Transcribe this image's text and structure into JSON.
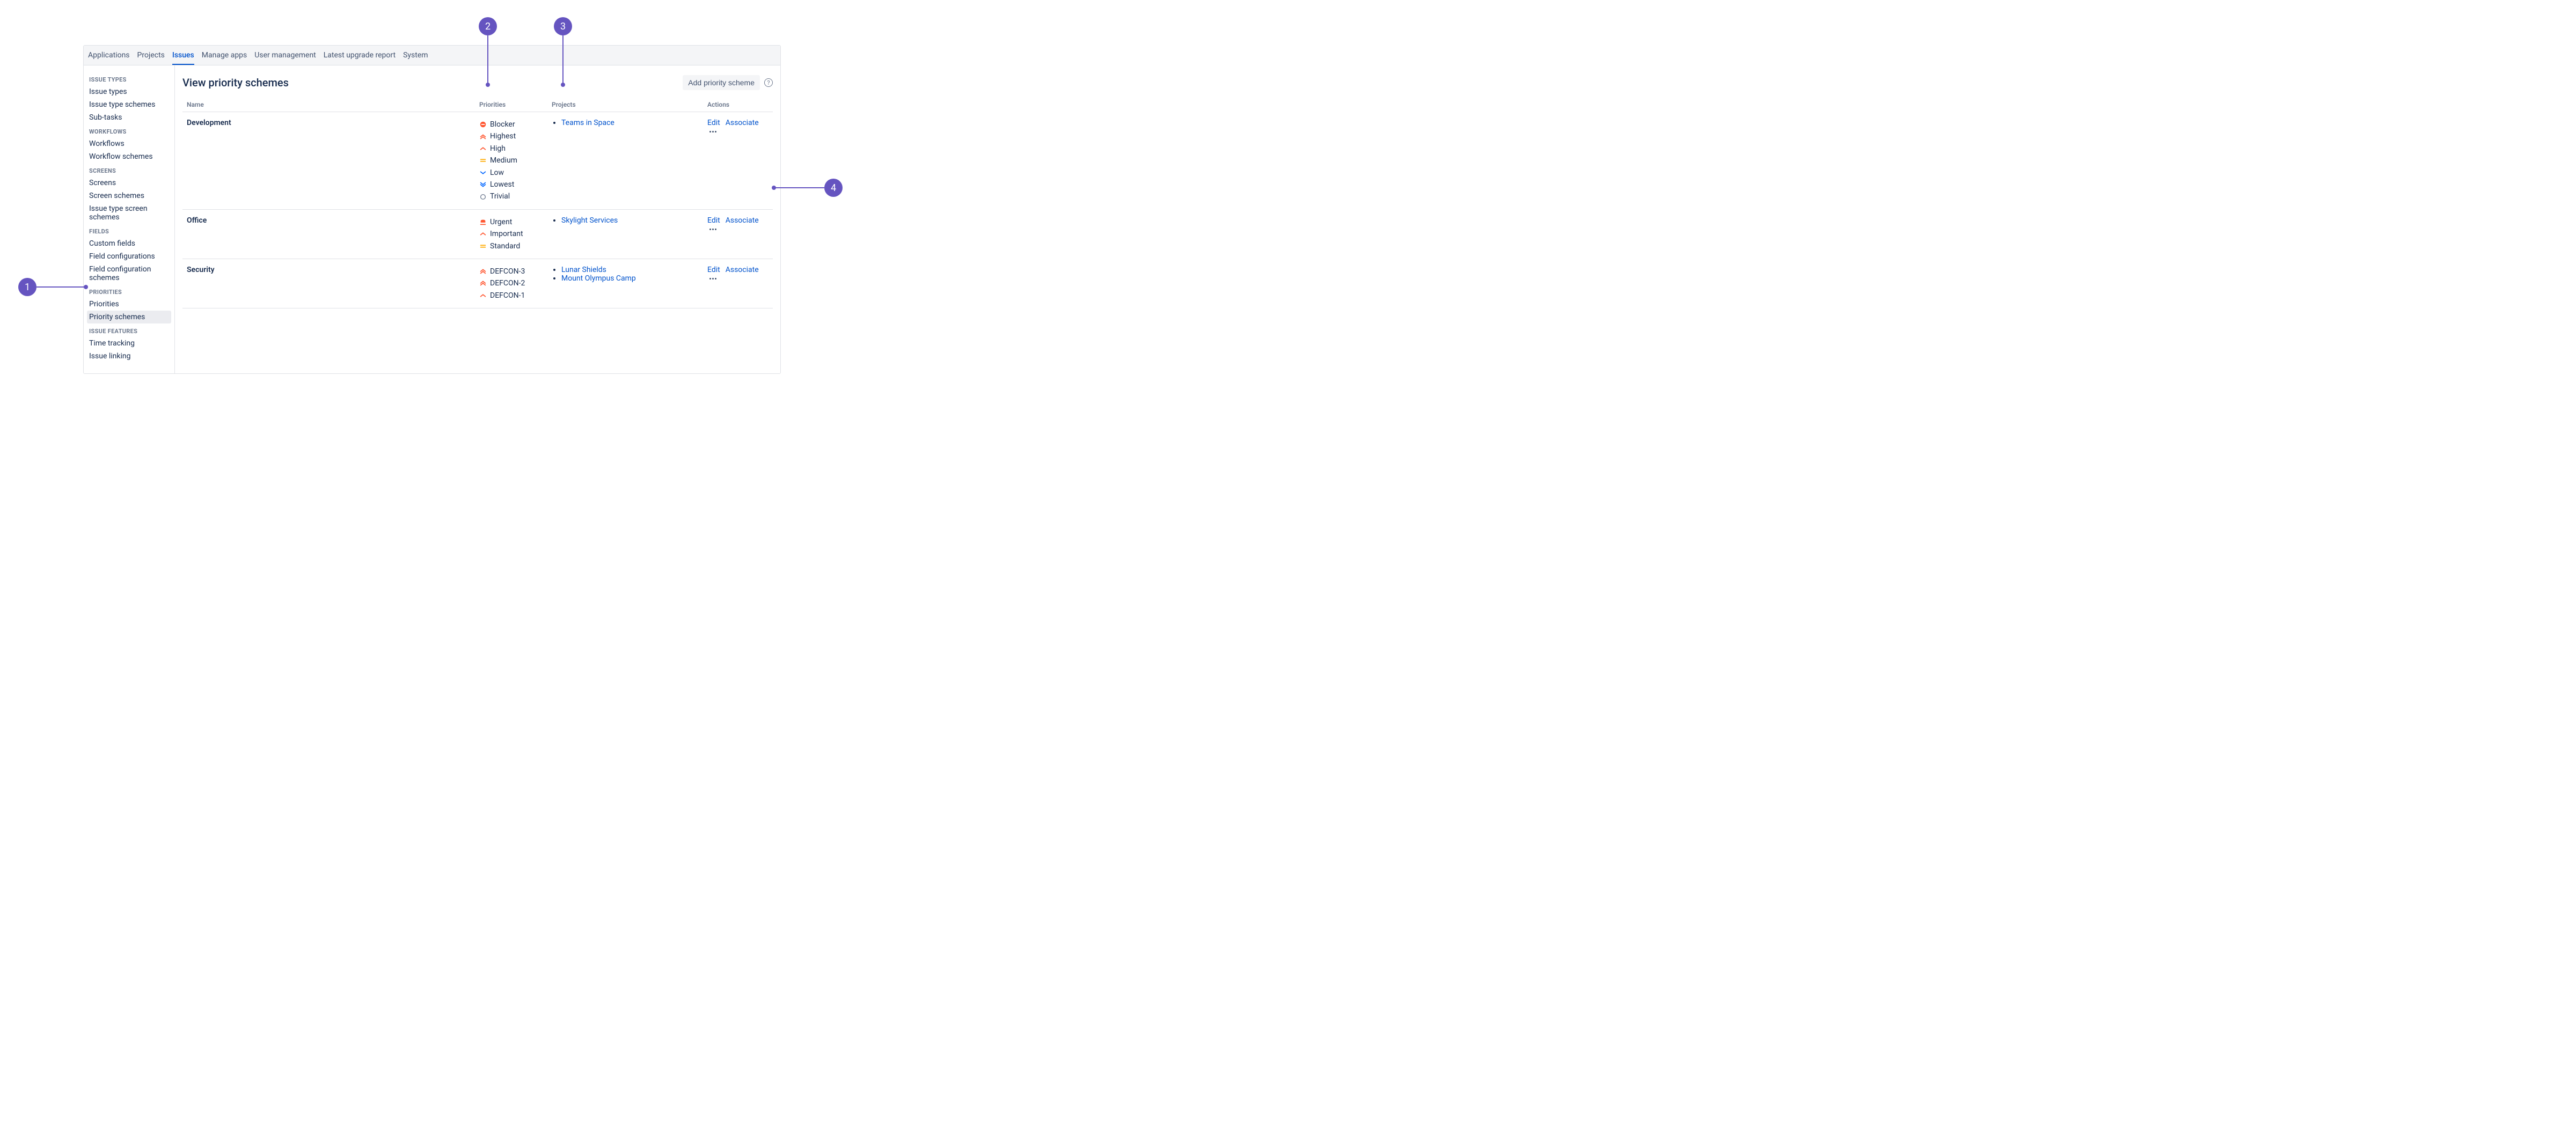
{
  "topnav": {
    "tabs": [
      "Applications",
      "Projects",
      "Issues",
      "Manage apps",
      "User management",
      "Latest upgrade report",
      "System"
    ],
    "active_index": 2
  },
  "sidebar": {
    "groups": [
      {
        "title": "Issue types",
        "items": [
          "Issue types",
          "Issue type schemes",
          "Sub-tasks"
        ]
      },
      {
        "title": "Workflows",
        "items": [
          "Workflows",
          "Workflow schemes"
        ]
      },
      {
        "title": "Screens",
        "items": [
          "Screens",
          "Screen schemes",
          "Issue type screen schemes"
        ]
      },
      {
        "title": "Fields",
        "items": [
          "Custom fields",
          "Field configurations",
          "Field configuration schemes"
        ]
      },
      {
        "title": "Priorities",
        "items": [
          "Priorities",
          "Priority schemes"
        ],
        "active_item_index": 1
      },
      {
        "title": "Issue features",
        "items": [
          "Time tracking",
          "Issue linking"
        ]
      }
    ]
  },
  "page": {
    "title": "View priority schemes",
    "add_button": "Add priority scheme"
  },
  "table": {
    "columns": [
      "Name",
      "Priorities",
      "Projects",
      "Actions"
    ],
    "actions": {
      "edit": "Edit",
      "associate": "Associate"
    },
    "rows": [
      {
        "name": "Development",
        "priorities": [
          {
            "icon": "blocker",
            "label": "Blocker"
          },
          {
            "icon": "highest",
            "label": "Highest"
          },
          {
            "icon": "high",
            "label": "High"
          },
          {
            "icon": "medium",
            "label": "Medium"
          },
          {
            "icon": "low",
            "label": "Low"
          },
          {
            "icon": "lowest",
            "label": "Lowest"
          },
          {
            "icon": "trivial",
            "label": "Trivial"
          }
        ],
        "projects": [
          "Teams in Space"
        ]
      },
      {
        "name": "Office",
        "priorities": [
          {
            "icon": "urgent",
            "label": "Urgent"
          },
          {
            "icon": "high",
            "label": "Important"
          },
          {
            "icon": "medium",
            "label": "Standard"
          }
        ],
        "projects": [
          "Skylight Services"
        ]
      },
      {
        "name": "Security",
        "priorities": [
          {
            "icon": "highest",
            "label": "DEFCON-3"
          },
          {
            "icon": "highest",
            "label": "DEFCON-2"
          },
          {
            "icon": "high",
            "label": "DEFCON-1"
          }
        ],
        "projects": [
          "Lunar Shields",
          "Mount Olympus Camp"
        ]
      }
    ]
  },
  "callouts": [
    "1",
    "2",
    "3",
    "4"
  ]
}
